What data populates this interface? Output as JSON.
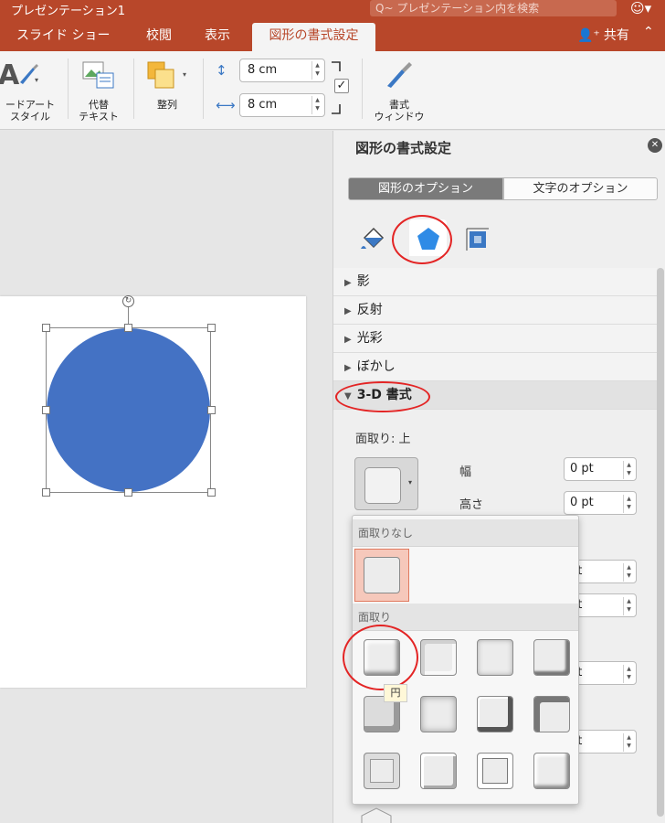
{
  "titlebar": {
    "title": "プレゼンテーション1",
    "search_placeholder": "Q~ プレゼンテーション内を検索"
  },
  "tabs": [
    {
      "label": "スライド ショー"
    },
    {
      "label": "校閲"
    },
    {
      "label": "表示"
    },
    {
      "label": "図形の書式設定",
      "active": true
    }
  ],
  "share_label": "共有",
  "ribbon": {
    "wordart_label": "ードアート\nスタイル",
    "alt_text_label": "代替\nテキスト",
    "arrange_label": "整列",
    "height_value": "8 cm",
    "width_value": "8 cm",
    "format_pane_label": "書式\nウィンドウ"
  },
  "pane": {
    "title": "図形の書式設定",
    "tab_shape_options": "図形のオプション",
    "tab_text_options": "文字のオプション",
    "category_icons": [
      "fill-line-icon",
      "effects-icon",
      "size-properties-icon"
    ],
    "sections": [
      {
        "label": "影",
        "open": false
      },
      {
        "label": "反射",
        "open": false
      },
      {
        "label": "光彩",
        "open": false
      },
      {
        "label": "ぼかし",
        "open": false
      },
      {
        "label": "3-D 書式",
        "open": true
      }
    ],
    "bevel_top_label": "面取り: 上",
    "width_label": "幅",
    "height_label": "高さ",
    "width_value": "0 pt",
    "height_value": "0 pt",
    "other_values": [
      "pt",
      "pt",
      "pt",
      "pt"
    ]
  },
  "gallery": {
    "no_bevel_header": "面取りなし",
    "bevel_header": "面取り",
    "tooltip": "円"
  },
  "colors": {
    "accent": "#b8472a",
    "shape_fill": "#4472c4",
    "annotation_ring": "#e32424"
  }
}
